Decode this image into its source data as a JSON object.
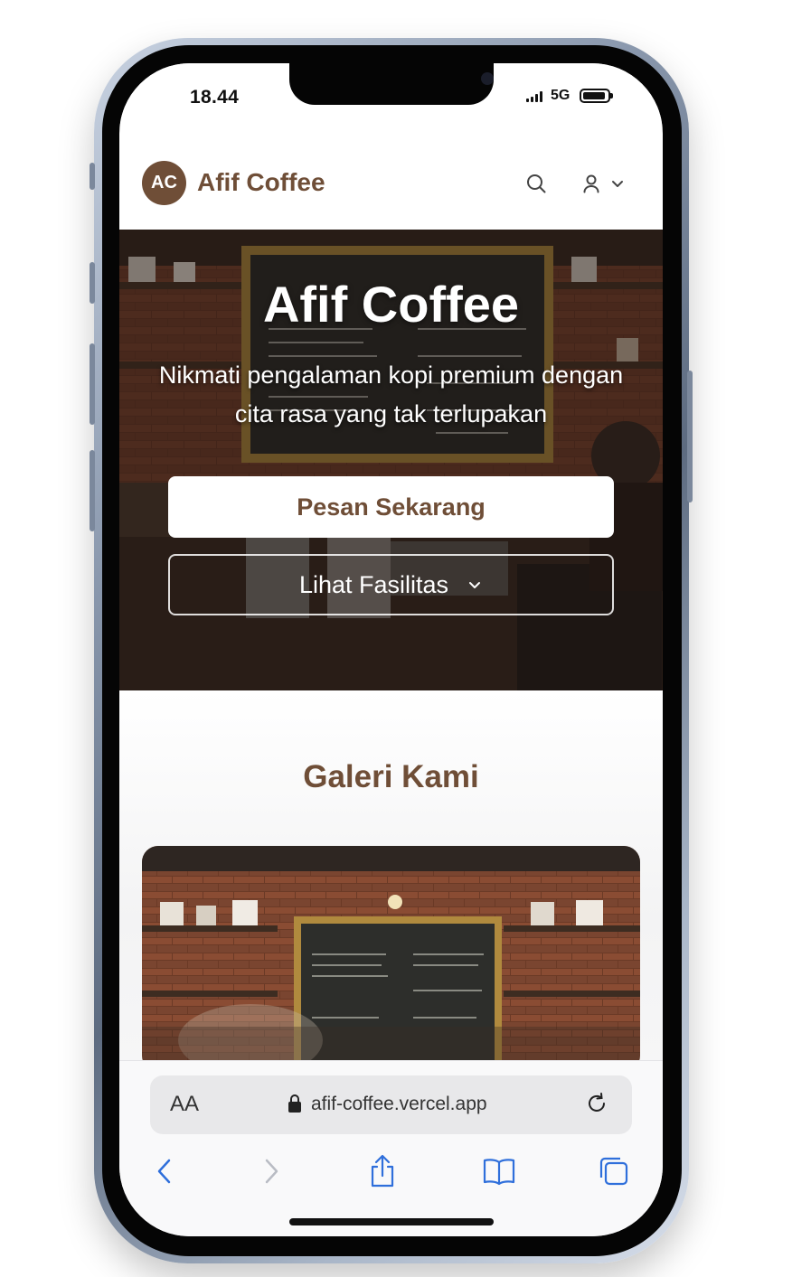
{
  "status_bar": {
    "time": "18.44",
    "network": "5G"
  },
  "header": {
    "logo_initials": "AC",
    "brand": "Afif Coffee"
  },
  "hero": {
    "title": "Afif Coffee",
    "subtitle": "Nikmati pengalaman kopi premium dengan cita rasa yang tak terlupakan",
    "primary_button": "Pesan Sekarang",
    "secondary_button": "Lihat Fasilitas"
  },
  "gallery": {
    "title": "Galeri Kami"
  },
  "browser": {
    "text_size_label": "AA",
    "url": "afif-coffee.vercel.app",
    "toolbar": [
      "back-icon",
      "forward-icon",
      "share-icon",
      "bookmarks-icon",
      "tabs-icon"
    ]
  },
  "colors": {
    "brand": "#6f4e37",
    "link_blue": "#2f6fdb"
  }
}
